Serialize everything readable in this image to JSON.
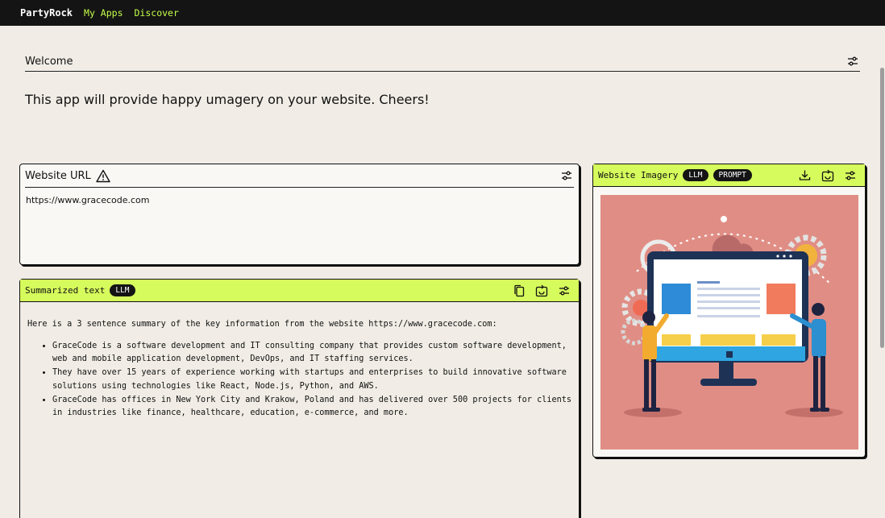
{
  "nav": {
    "brand": "PartyRock",
    "links": [
      "My Apps",
      "Discover"
    ]
  },
  "welcome": {
    "title": "Welcome",
    "description": "This app will provide happy umagery on your website. Cheers!"
  },
  "website_url": {
    "title": "Website URL",
    "value": "https://www.gracecode.com"
  },
  "summarized": {
    "title": "Summarized text",
    "badge": "LLM",
    "intro": "Here is a 3 sentence summary of the key information from the website https://www.gracecode.com:",
    "items": [
      "GraceCode is a software development and IT consulting company that provides custom software development, web and mobile application development, DevOps, and IT staffing services.",
      "They have over 15 years of experience working with startups and enterprises to build innovative software solutions using technologies like React, Node.js, Python, and AWS.",
      "GraceCode has offices in New York City and Krakow, Poland and has delivered over 500 projects for clients in industries like finance, healthcare, education, e-commerce, and more."
    ]
  },
  "imagery": {
    "title": "Website Imagery",
    "badges": [
      "LLM",
      "PROMPT"
    ]
  },
  "icons": {
    "settings": "sliders-icon",
    "warning": "warning-icon",
    "copy": "copy-icon",
    "regenerate": "regenerate-icon",
    "download": "download-icon"
  },
  "colors": {
    "accent": "#d6fb5c",
    "topbar": "#141414",
    "background": "#f1ede6",
    "image_bg": "#e08e85"
  }
}
